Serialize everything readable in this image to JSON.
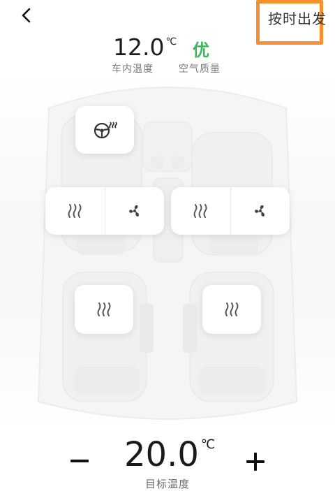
{
  "header": {
    "back_icon": "chevron-left-icon",
    "scheduled_departure_label": "按时出发",
    "highlight_color": "#f7912e"
  },
  "status": {
    "cabin_temperature": {
      "value": "12.0",
      "unit": "℃",
      "label": "车内温度"
    },
    "air_quality": {
      "value": "优",
      "label": "空气质量",
      "color": "#3bb95a"
    }
  },
  "seat_controls": {
    "steering_wheel_heat": {
      "icon": "steering-wheel-heat-icon"
    },
    "driver_seat": {
      "heat_icon": "seat-heat-icon",
      "ventilation_icon": "fan-icon"
    },
    "passenger_seat": {
      "heat_icon": "seat-heat-icon",
      "ventilation_icon": "fan-icon"
    },
    "rear_left_seat": {
      "heat_icon": "seat-heat-icon"
    },
    "rear_right_seat": {
      "heat_icon": "seat-heat-icon"
    }
  },
  "target_temperature": {
    "value": "20.0",
    "unit": "℃",
    "label": "目标温度",
    "decrease_label": "−",
    "increase_label": "+"
  }
}
